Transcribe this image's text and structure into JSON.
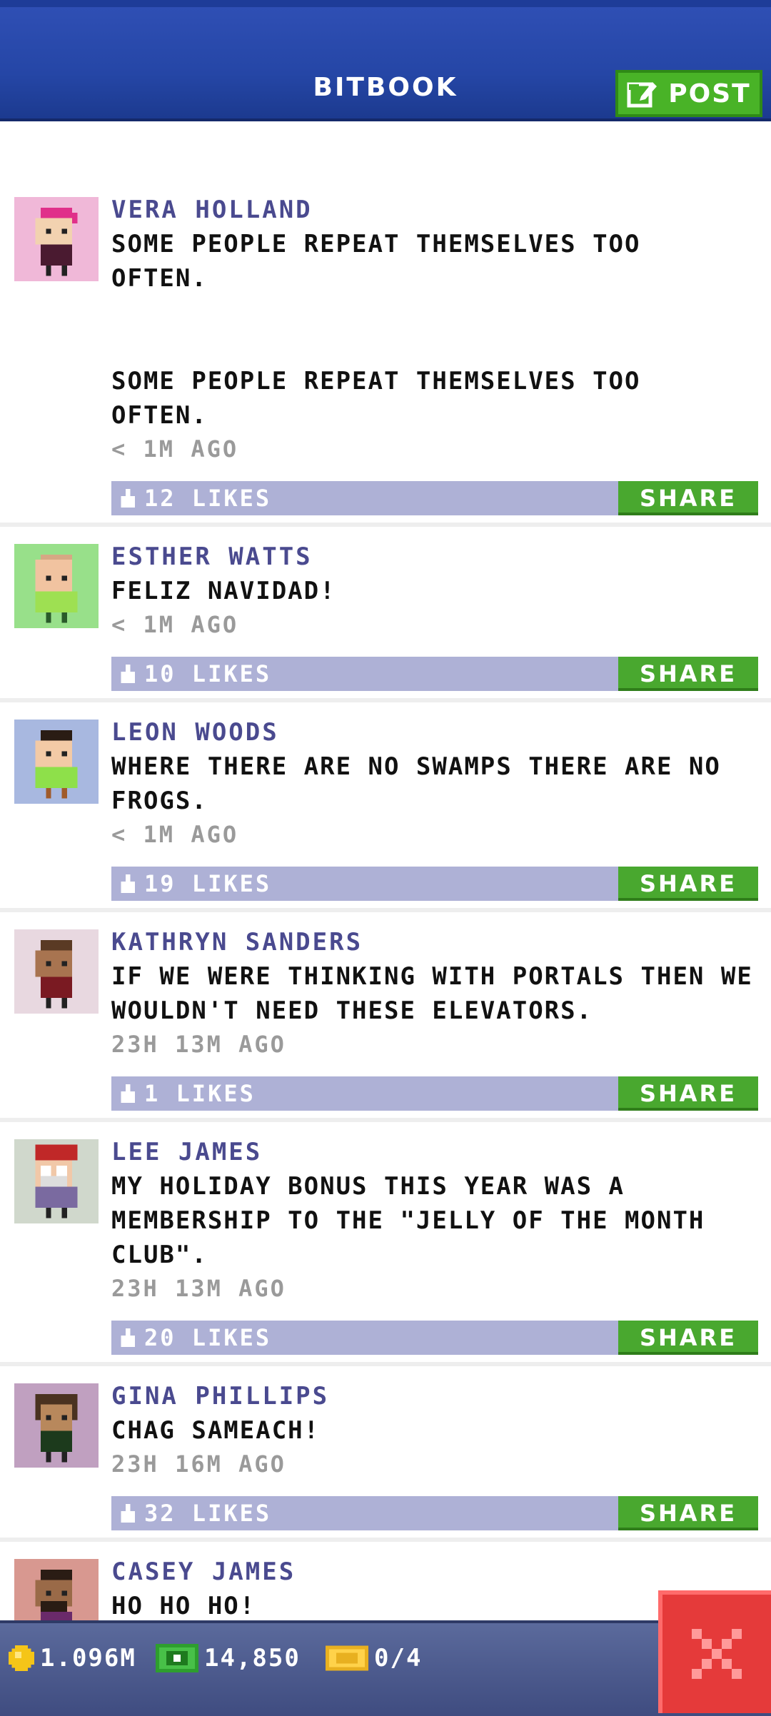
{
  "header": {
    "title": "BITBOOK",
    "post_label": "POST"
  },
  "posts": [
    {
      "name": "VERA HOLLAND",
      "text": "SOME PEOPLE REPEAT THEMSELVES TOO\nOFTEN.\n\n\nSOME PEOPLE REPEAT THEMSELVES TOO\nOFTEN.",
      "time": "< 1M AGO",
      "likes": "12 LIKES",
      "share": "SHARE",
      "avatar_bg": "#f0b8d8",
      "hair": "#e0308a",
      "skin": "#f2d2b0",
      "shirt": "#4a1a30"
    },
    {
      "name": "ESTHER WATTS",
      "text": "FELIZ NAVIDAD!",
      "time": "< 1M AGO",
      "likes": "10 LIKES",
      "share": "SHARE",
      "avatar_bg": "#98e08a",
      "hair": "#d6a884",
      "skin": "#f1c3a0",
      "shirt": "#9ee052"
    },
    {
      "name": "LEON WOODS",
      "text": "WHERE THERE ARE NO SWAMPS THERE ARE NO\nFROGS.",
      "time": "< 1M AGO",
      "likes": "19 LIKES",
      "share": "SHARE",
      "avatar_bg": "#a8b8e0",
      "hair": "#2a1c14",
      "skin": "#f3caa6",
      "shirt": "#8ee04a"
    },
    {
      "name": "KATHRYN SANDERS",
      "text": "IF WE WERE THINKING WITH PORTALS THEN WE\nWOULDN'T NEED THESE ELEVATORS.",
      "time": "23H 13M AGO",
      "likes": "1 LIKES",
      "share": "SHARE",
      "avatar_bg": "#e8d8e0",
      "hair": "#5a3a24",
      "skin": "#a87450",
      "shirt": "#7a1a22"
    },
    {
      "name": "LEE JAMES",
      "text": "MY HOLIDAY BONUS THIS YEAR WAS A\nMEMBERSHIP TO THE \"JELLY OF THE MONTH\nCLUB\".",
      "time": "23H 13M AGO",
      "likes": "20 LIKES",
      "share": "SHARE",
      "avatar_bg": "#d0d8cc",
      "hair": "#c02828",
      "skin": "#f1c8a8",
      "shirt": "#7a6aa0"
    },
    {
      "name": "GINA PHILLIPS",
      "text": "CHAG SAMEACH!",
      "time": "23H 16M AGO",
      "likes": "32 LIKES",
      "share": "SHARE",
      "avatar_bg": "#c0a0c0",
      "hair": "#4a3220",
      "skin": "#b8885c",
      "shirt": "#1c3a1c"
    },
    {
      "name": "CASEY JAMES",
      "text": "HO HO HO!",
      "time": "",
      "likes": "",
      "share": "",
      "avatar_bg": "#d89890",
      "hair": "#2a1c14",
      "skin": "#9a6a48",
      "shirt": "#6a2a6a"
    }
  ],
  "footer": {
    "coins": "1.096M",
    "bux": "14,850",
    "tickets": "0/4"
  },
  "colors": {
    "header_blue": "#2546a6",
    "accent_green": "#49b327",
    "like_bar": "#aeb1d6",
    "name_color": "#4a4a8f",
    "close_red": "#e53a3a"
  },
  "icons": {
    "post": "edit-icon",
    "like": "thumb-up-icon",
    "coin": "coin-icon",
    "bux": "bux-icon",
    "ticket": "ticket-icon",
    "close": "close-icon"
  }
}
